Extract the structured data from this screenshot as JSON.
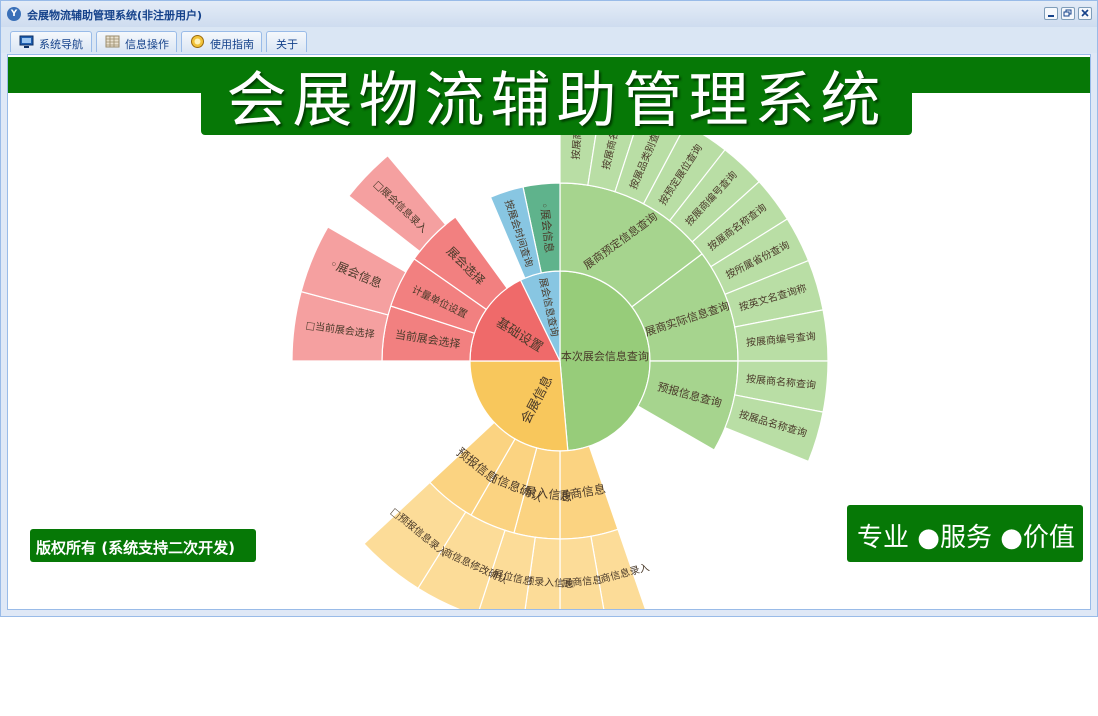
{
  "window": {
    "title": "会展物流辅助管理系统(非注册用户)",
    "icon": "app-logo-icon"
  },
  "tabs": [
    {
      "label": "系统导航",
      "icon": "monitor-icon"
    },
    {
      "label": "信息操作",
      "icon": "grid-icon"
    },
    {
      "label": "使用指南",
      "icon": "help-globe-icon"
    },
    {
      "label": "关于",
      "icon": ""
    }
  ],
  "banner": {
    "title": "会展物流辅助管理系统"
  },
  "footer": {
    "copyright": "版权所有 (系统支持二次开发)",
    "slogan": "专业 ●服务 ●价值"
  },
  "colors": {
    "window_bg": "#dfe8f6",
    "banner_green": "#067806",
    "red_inner": "#ef6a6a",
    "red_mid": "#f28080",
    "red_outer": "#f5a0a0",
    "green_inner": "#97cc7a",
    "green_mid": "#a6d48e",
    "green_outer": "#b9dea5",
    "yellow_inner": "#f8c75c",
    "yellow_mid": "#fbd381",
    "yellow_outer": "#fcdc98",
    "teal": "#5fb38c",
    "blue": "#88c6e2"
  },
  "sunburst": {
    "groups": [
      {
        "label": "基础设置",
        "color": "red",
        "start": -165,
        "end": -116,
        "children": [
          {
            "label": "当前展会选择",
            "start": -165,
            "end": -148,
            "children": [
              {
                "label": "□当前展会选择",
                "start": -165,
                "end": -148,
                "leaf": true
              }
            ]
          },
          {
            "label": "计量单位设置",
            "start": -148,
            "end": -139,
            "children": []
          },
          {
            "label": "展会选择",
            "start": -139,
            "end": -116,
            "children": [
              {
                "label": "◦展会信息",
                "start": -148,
                "end": -139,
                "parent_mid": true
              },
              {
                "label": "□展会信息录入",
                "start": -131,
                "end": -120,
                "leaf": true
              }
            ]
          }
        ]
      },
      {
        "label": "展会信息查询",
        "color": "teal",
        "start": -115,
        "end": -100,
        "children": [
          {
            "label": "按展会时间查询",
            "start": -106,
            "end": -96
          },
          {
            "label": "◦展会信息",
            "start": -96,
            "end": -90
          }
        ]
      },
      {
        "label": "本次展会信息查询",
        "color": "green",
        "start": -90,
        "end": 20,
        "children": [
          {
            "label": "展商预定信息查询",
            "start": -90,
            "end": -37
          },
          {
            "label": "展商实际信息查询",
            "start": -37,
            "end": 0
          },
          {
            "label": "预报信息查询",
            "start": 0,
            "end": 30
          }
        ],
        "leaves": [
          "按展商编",
          "按展商名称",
          "按展品类别查询",
          "按预定展位查询",
          "按展商编号查询",
          "按展商名称查询",
          "按所属省份查询",
          "按英文名查询称",
          "按展商编号查询",
          "按展商名称查询",
          "按展品名称查询"
        ]
      },
      {
        "label": "会展信息",
        "color": "yellow",
        "start": 20,
        "end": 115,
        "children": [
          {
            "label": "展商信息",
            "start": 20,
            "end": 42
          },
          {
            "label": "预录入信息",
            "start": 42,
            "end": 65
          },
          {
            "label": "展商信息确认",
            "start": 65,
            "end": 85
          },
          {
            "label": "预报信息",
            "start": 85,
            "end": 115
          }
        ],
        "leaves": [
          "□展商信息录入",
          "◦展商信息",
          "□预录入信息",
          "◦展位信息",
          "□展商信息修改确认",
          "□预报信息录入"
        ]
      }
    ]
  }
}
